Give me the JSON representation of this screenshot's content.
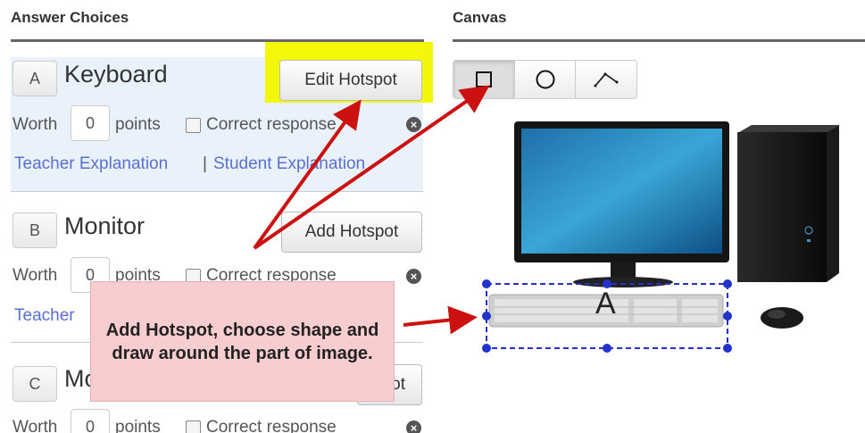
{
  "answer_panel": {
    "heading": "Answer Choices",
    "choices": [
      {
        "letter": "A",
        "title": "Keyboard",
        "hotspot_button": "Edit Hotspot",
        "worth_label": "Worth",
        "worth_value": "0",
        "points_label": "points",
        "correct_label": "Correct response",
        "teacher_link": "Teacher Explanation",
        "separator": "|",
        "student_link": "Student Explanation"
      },
      {
        "letter": "B",
        "title": "Monitor",
        "hotspot_button": "Add Hotspot",
        "worth_label": "Worth",
        "worth_value": "0",
        "points_label": "points",
        "correct_label": "Correct response",
        "teacher_link": "Teacher"
      },
      {
        "letter": "C",
        "title": "Mo",
        "hotspot_button": "ot",
        "worth_label": "Worth",
        "worth_value": "0",
        "points_label": "points",
        "correct_label": "Correct response"
      }
    ]
  },
  "canvas": {
    "heading": "Canvas",
    "tools": [
      "rectangle-tool",
      "circle-tool",
      "polygon-tool"
    ],
    "active_tool": "rectangle-tool",
    "hotspot_label": "A"
  },
  "callout": {
    "text": "Add Hotspot, choose shape and draw around the part of image."
  },
  "colors": {
    "highlight": "#f3f70a",
    "arrow": "#cc1111",
    "hotspot_outline": "#2233cc",
    "callout_bg": "#f7cdd0",
    "link": "#5b6fd1",
    "active_choice_bg": "#e9f2fb"
  }
}
